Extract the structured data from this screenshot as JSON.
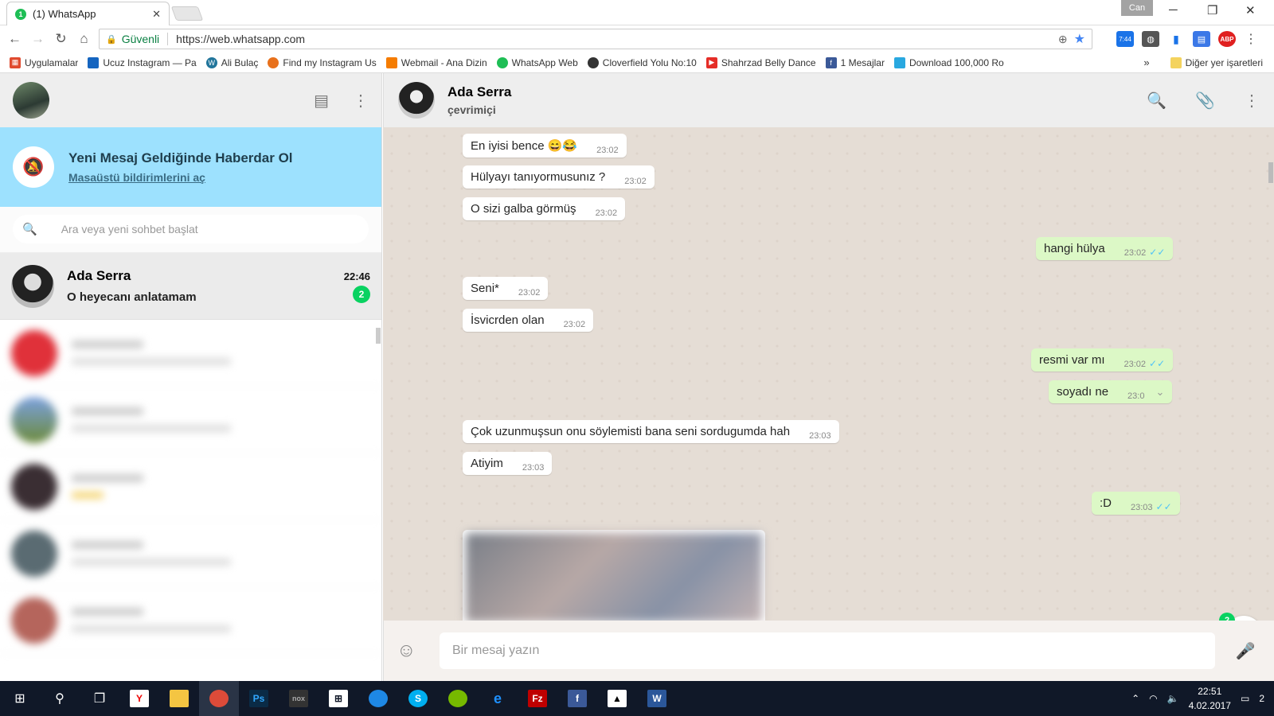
{
  "browser": {
    "tab_title": "(1) WhatsApp",
    "tab_badge": "1",
    "profile": "Can",
    "secure_label": "Güvenli",
    "url": "https://web.whatsapp.com",
    "extension_badge": "7:44",
    "abp_label": "ABP"
  },
  "bookmarks": [
    {
      "label": "Uygulamalar",
      "color": "#e04b2f"
    },
    {
      "label": "Ucuz Instagram — Pa",
      "color": "#1565c0"
    },
    {
      "label": "Ali Bulaç",
      "color": "#21759b"
    },
    {
      "label": "Find my Instagram Us",
      "color": "#e8711c"
    },
    {
      "label": "Webmail - Ana Dizin",
      "color": "#f57c00"
    },
    {
      "label": "WhatsApp Web",
      "color": "#1ebe55"
    },
    {
      "label": "Cloverfield Yolu No:10",
      "color": "#333333"
    },
    {
      "label": "Shahrzad Belly Dance",
      "color": "#e52d27"
    },
    {
      "label": "1 Mesajlar",
      "color": "#3b5998"
    },
    {
      "label": "Download 100,000 Ro",
      "color": "#29a8e0"
    }
  ],
  "bookmarks_more": "»",
  "bookmarks_other": "Diğer yer işaretleri",
  "notification": {
    "title": "Yeni Mesaj Geldiğinde Haberdar Ol",
    "link": "Masaüstü bildirimlerini aç"
  },
  "search": {
    "placeholder": "Ara veya yeni sohbet başlat"
  },
  "active_chat": {
    "name": "Ada Serra",
    "time": "22:46",
    "last_message": "O heyecanı anlatamam",
    "unread": "2"
  },
  "contact": {
    "name": "Ada Serra",
    "status": "çevrimiçi"
  },
  "messages": [
    {
      "text": "En iyisi bence 😄😂",
      "time": "23:02",
      "dir": "in"
    },
    {
      "text": "Hülyayı tanıyormusunız ?",
      "time": "23:02",
      "dir": "in"
    },
    {
      "text": "O sizi galba görmüş",
      "time": "23:02",
      "dir": "in"
    },
    {
      "text": "hangi hülya",
      "time": "23:02",
      "dir": "out"
    },
    {
      "text": "Seni*",
      "time": "23:02",
      "dir": "in"
    },
    {
      "text": "İsvicrden olan",
      "time": "23:02",
      "dir": "in"
    },
    {
      "text": "resmi var mı",
      "time": "23:02",
      "dir": "out"
    },
    {
      "text": "soyadı ne",
      "time": "23:0",
      "dir": "out"
    },
    {
      "text": "Çok uzunmuşsun onu söylemisti bana seni sordugumda hah",
      "time": "23:03",
      "dir": "in"
    },
    {
      "text": "Atiyim",
      "time": "23:03",
      "dir": "in"
    },
    {
      "text": ":D",
      "time": "23:03",
      "dir": "out"
    }
  ],
  "scroll_badge": "2",
  "composer": {
    "placeholder": "Bir mesaj yazın"
  },
  "taskbar": {
    "time": "22:51",
    "date": "4.02.2017",
    "notif_count": "2"
  }
}
